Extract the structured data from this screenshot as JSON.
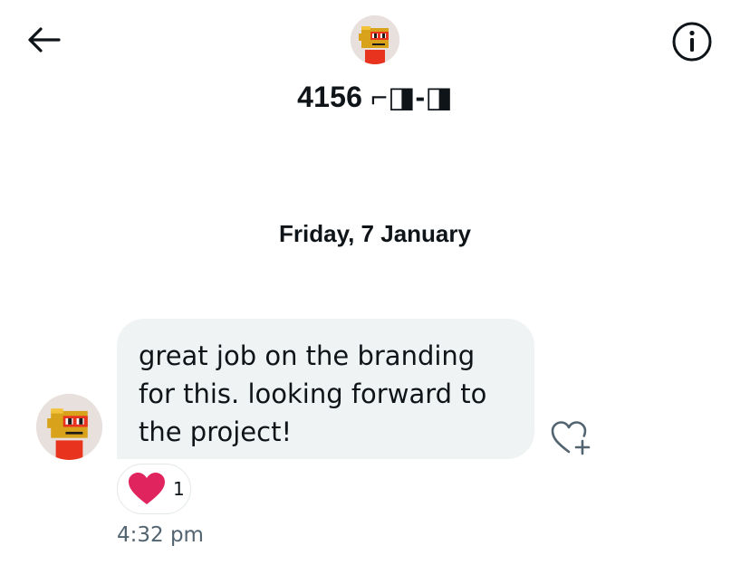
{
  "header": {
    "title": "4156 ⌐◨-◨",
    "back_icon": "arrow-left-icon",
    "info_icon": "info-circle-icon"
  },
  "conversation": {
    "date_separator": "Friday, 7 January",
    "messages": [
      {
        "text": "great job on the branding for this. looking forward to the project!",
        "reaction": {
          "icon": "heart-icon",
          "color": "#e0245e",
          "count": "1"
        },
        "timestamp": "4:32 pm",
        "add_reaction_icon": "heart-plus-icon"
      }
    ]
  },
  "colors": {
    "bubble": "#eff3f4",
    "text": "#0f1419",
    "muted": "#536471",
    "heart": "#e0245e"
  }
}
